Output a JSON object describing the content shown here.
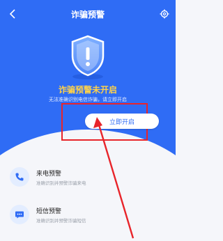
{
  "header": {
    "title": "诈骗预警"
  },
  "status": {
    "headline": "诈骗预警未开启",
    "subline": "无法准确识别电信诈骗，请立即开启"
  },
  "actions": {
    "enable_label": "立即开启"
  },
  "features": [
    {
      "name": "来电预警",
      "desc": "准确识别并预警诈骗来电",
      "icon": "phone-icon"
    },
    {
      "name": "短信预警",
      "desc": "准确识别并预警诈骗短信",
      "icon": "sms-icon"
    }
  ],
  "colors": {
    "primary": "#2f6cf5",
    "warning_text": "#ffd24a",
    "highlight": "#e8242a",
    "page_bg": "#f5f6fa"
  }
}
